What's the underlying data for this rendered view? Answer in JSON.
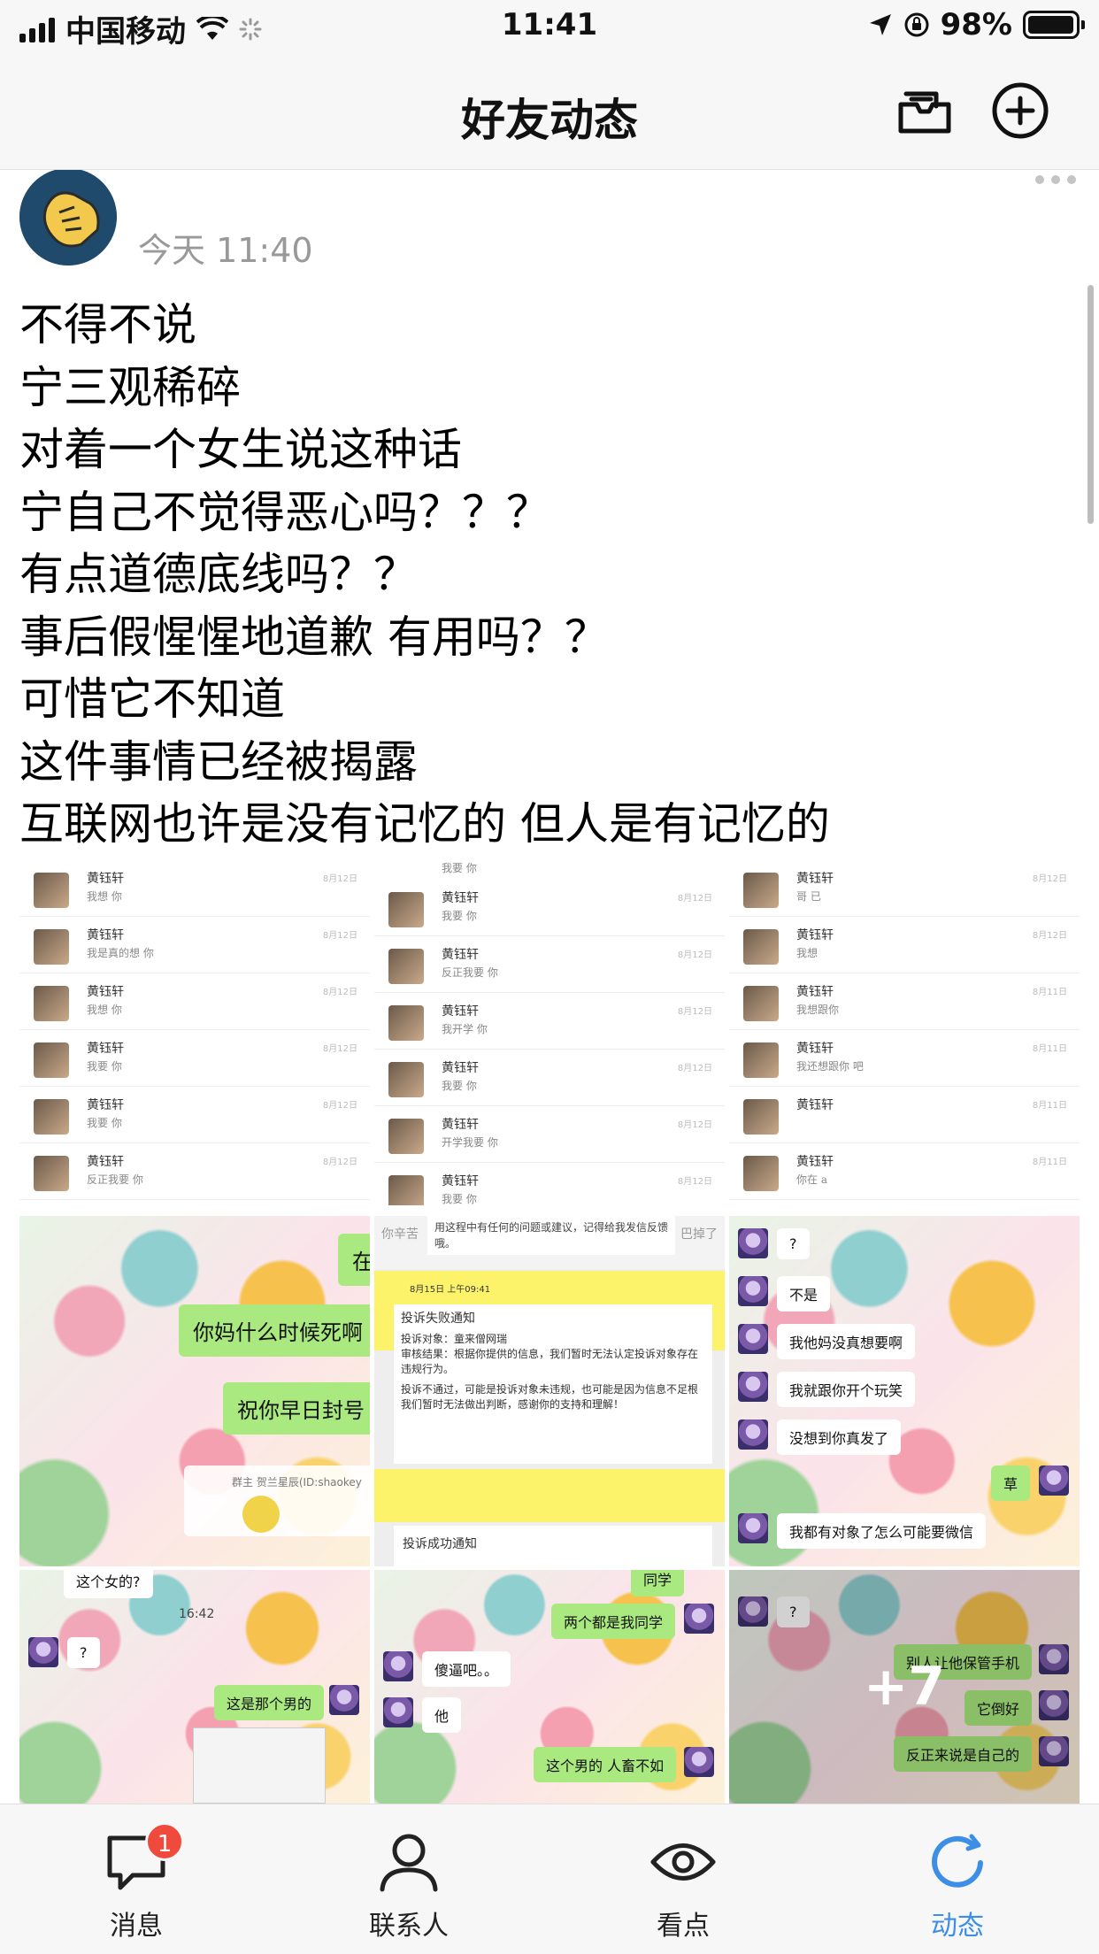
{
  "status_bar": {
    "carrier": "中国移动",
    "time": "11:41",
    "battery": "98%",
    "battery_level": 0.98
  },
  "header": {
    "title": "好友动态"
  },
  "post": {
    "time": "今天 11:40",
    "lines": [
      "不得不说",
      "宁三观稀碎",
      "对着一个女生说这种话",
      "宁自己不觉得恶心吗？？？",
      "有点道德底线吗？？",
      "事后假惺惺地道歉 有用吗？？",
      "可惜它不知道",
      "这件事情已经被揭露",
      "互联网也许是没有记忆的 但人是有记忆的"
    ],
    "photos": {
      "chat_list_1": {
        "rows": [
          {
            "name": "黄钰轩",
            "msg": "我想 你",
            "date": "8月12日"
          },
          {
            "name": "黄钰轩",
            "msg": "我是真的想 你",
            "date": "8月12日"
          },
          {
            "name": "黄钰轩",
            "msg": "我想 你",
            "date": "8月12日"
          },
          {
            "name": "黄钰轩",
            "msg": "我要 你",
            "date": "8月12日"
          },
          {
            "name": "黄钰轩",
            "msg": "我要 你",
            "date": "8月12日"
          },
          {
            "name": "黄钰轩",
            "msg": "反正我要 你",
            "date": "8月12日"
          }
        ]
      },
      "chat_list_2": {
        "top": "我要 你",
        "rows": [
          {
            "name": "黄钰轩",
            "msg": "我要 你",
            "date": "8月12日"
          },
          {
            "name": "黄钰轩",
            "msg": "反正我要 你",
            "date": "8月12日"
          },
          {
            "name": "黄钰轩",
            "msg": "我开学 你",
            "date": "8月12日"
          },
          {
            "name": "黄钰轩",
            "msg": "我要 你",
            "date": "8月12日"
          },
          {
            "name": "黄钰轩",
            "msg": "开学我要 你",
            "date": "8月12日"
          },
          {
            "name": "黄钰轩",
            "msg": "我要 你",
            "date": "8月12日"
          }
        ]
      },
      "chat_list_3": {
        "rows": [
          {
            "name": "黄钰轩",
            "msg": "哥 已",
            "date": "8月12日"
          },
          {
            "name": "黄钰轩",
            "msg": "我想",
            "date": "8月12日"
          },
          {
            "name": "黄钰轩",
            "msg": "我想跟你",
            "date": "8月11日"
          },
          {
            "name": "黄钰轩",
            "msg": "我还想跟你 吧",
            "date": "8月11日"
          },
          {
            "name": "黄钰轩",
            "msg": "",
            "date": "8月11日"
          },
          {
            "name": "黄钰轩",
            "msg": "你在 a",
            "date": "8月11日"
          }
        ]
      },
      "chat_abuse": {
        "bubble1": "你妈什么时候死啊",
        "bubble2": "祝你早日封号",
        "bubble_top": "在",
        "group_tag": "群主 贺兰星辰(ID:shaokey"
      },
      "complaint": {
        "top_text": "用这程中有任何的问题或建议，记得给我发信反馈哦。",
        "top_left": "你辛苦",
        "top_right": "巴掉了",
        "title": "投诉失败通知",
        "target": "投诉对象：童来僧网瑞",
        "result": "审核结果：根据你提供的信息，我们暂时无法认定投诉对象存在违规行为。",
        "note": "投诉不通过，可能是投诉对象未违规，也可能是因为信息不足根我们暂时无法做出判断，感谢你的支持和理解！",
        "date": "8月15日 上午09:41",
        "bottom": "投诉成功通知"
      },
      "chat_3": {
        "q": "?",
        "m1": "不是",
        "m2": "我他妈没真想要啊",
        "m3": "我就跟你开个玩笑",
        "m4": "没想到你真发了",
        "reply": "草",
        "m5": "我都有对象了怎么可能要微信"
      },
      "chat_4": {
        "top": "这个女的?",
        "time": "16:42",
        "q": "?",
        "reply": "这是那个男的"
      },
      "chat_5": {
        "top": "同学",
        "reply1": "两个都是我同学",
        "m1": "傻逼吧。。",
        "m2": "他",
        "reply2": "这个男的 人畜不如"
      },
      "chat_6": {
        "q": "?",
        "r1": "别人让他保管手机",
        "r2": "它倒好",
        "r3": "反正来说是自己的",
        "more": "+7"
      }
    }
  },
  "tab_bar": {
    "tabs": [
      {
        "label": "消息",
        "icon": "message-icon",
        "badge": "1"
      },
      {
        "label": "联系人",
        "icon": "contacts-icon"
      },
      {
        "label": "看点",
        "icon": "eye-icon"
      },
      {
        "label": "动态",
        "icon": "refresh-icon",
        "active": true
      }
    ]
  },
  "colors": {
    "accent": "#3d8ee6",
    "badge": "#f04a3c",
    "chat_green": "#a9e97f"
  }
}
